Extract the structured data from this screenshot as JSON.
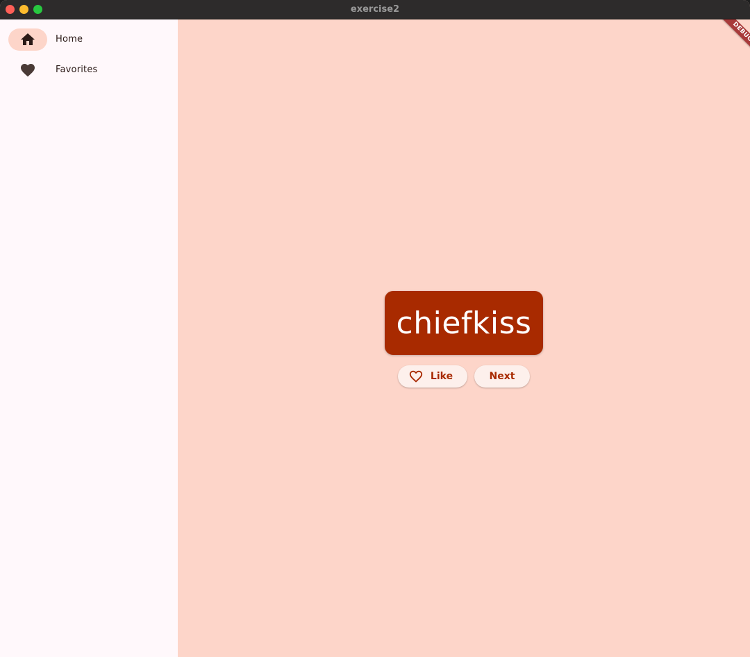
{
  "window": {
    "title": "exercise2"
  },
  "sidebar": {
    "items": [
      {
        "label": "Home",
        "icon": "home-icon",
        "selected": true
      },
      {
        "label": "Favorites",
        "icon": "heart-icon",
        "selected": false
      }
    ]
  },
  "main": {
    "word": "chiefkiss",
    "like_label": "Like",
    "like_icon": "heart-outline-icon",
    "next_label": "Next"
  },
  "debug_banner": {
    "label": "DEBUG"
  },
  "colors": {
    "primary": "#a82a00",
    "background": "#fdd5c9",
    "sidebar_bg": "#fff8fb",
    "button_bg": "#fdf0ec",
    "debug_banner": "#a83a3a"
  }
}
